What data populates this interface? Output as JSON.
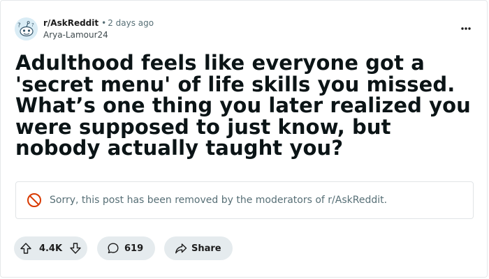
{
  "post": {
    "subreddit": "r/AskReddit",
    "separator": "•",
    "time_ago": "2 days ago",
    "author": "Arya-Lamour24",
    "title": "Adulthood feels like everyone got a 'secret menu' of life skills you missed. What’s one thing you later realized you were supposed to just know, but nobody actually taught you?",
    "removed_notice": "Sorry, this post has been removed by the moderators of r/AskReddit."
  },
  "actions": {
    "upvote_count": "4.4K",
    "comment_count": "619",
    "share_label": "Share"
  },
  "icons": {
    "avatar": "reddit-snoo-icon",
    "more": "more-options-icon",
    "removed": "prohibited-icon",
    "upvote": "upvote-arrow-icon",
    "downvote": "downvote-arrow-icon",
    "comment": "comment-bubble-icon",
    "share": "share-arrow-icon"
  },
  "colors": {
    "removed_icon": "#d93a00",
    "pill_bg": "#e5ebee",
    "muted_text": "#576f76"
  }
}
